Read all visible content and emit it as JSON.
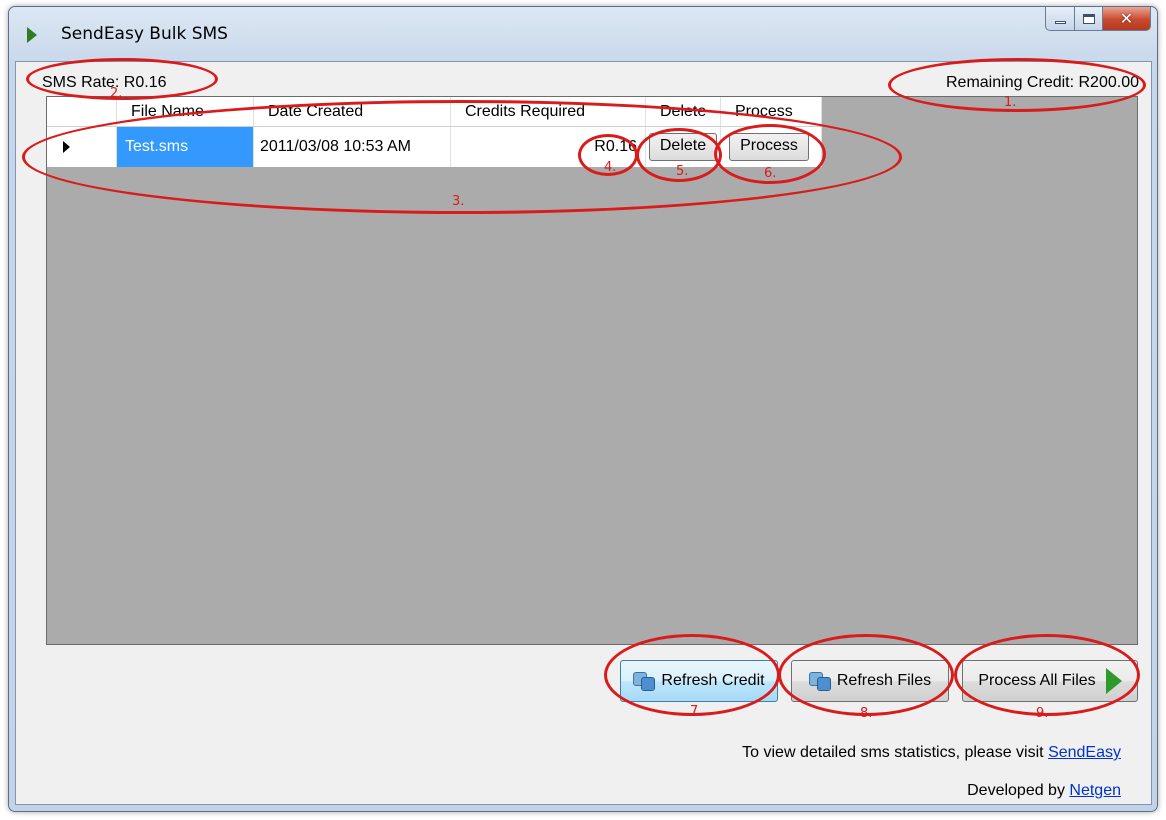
{
  "window": {
    "title": "SendEasy Bulk SMS"
  },
  "header": {
    "sms_rate": "SMS Rate:  R0.16",
    "remaining_credit": "Remaining Credit: R200.00"
  },
  "grid": {
    "columns": [
      "File Name",
      "Date Created",
      "Credits Required",
      "Delete",
      "Process"
    ],
    "rows": [
      {
        "file_name": "Test.sms",
        "date_created": "2011/03/08 10:53 AM",
        "credits_required": "R0.16",
        "delete_label": "Delete",
        "process_label": "Process"
      }
    ]
  },
  "buttons": {
    "refresh_credit": "Refresh Credit",
    "refresh_files": "Refresh Files",
    "process_all": "Process All Files"
  },
  "footer": {
    "stats_text": "To view detailed sms statistics, please visit",
    "stats_link": "SendEasy",
    "dev_text": "Developed by",
    "dev_link": "Netgen"
  },
  "annotations": [
    "1.",
    "2.",
    "3.",
    "4.",
    "5.",
    "6.",
    "7.",
    "8.",
    "9."
  ],
  "colors": {
    "annotation": "#d91b1b",
    "selection": "#3399ff",
    "link": "#0033cc",
    "grid_bg": "#ababab"
  },
  "icons": {
    "app": "green-play-icon",
    "refresh": "refresh-icon",
    "process_all": "green-play-icon"
  }
}
